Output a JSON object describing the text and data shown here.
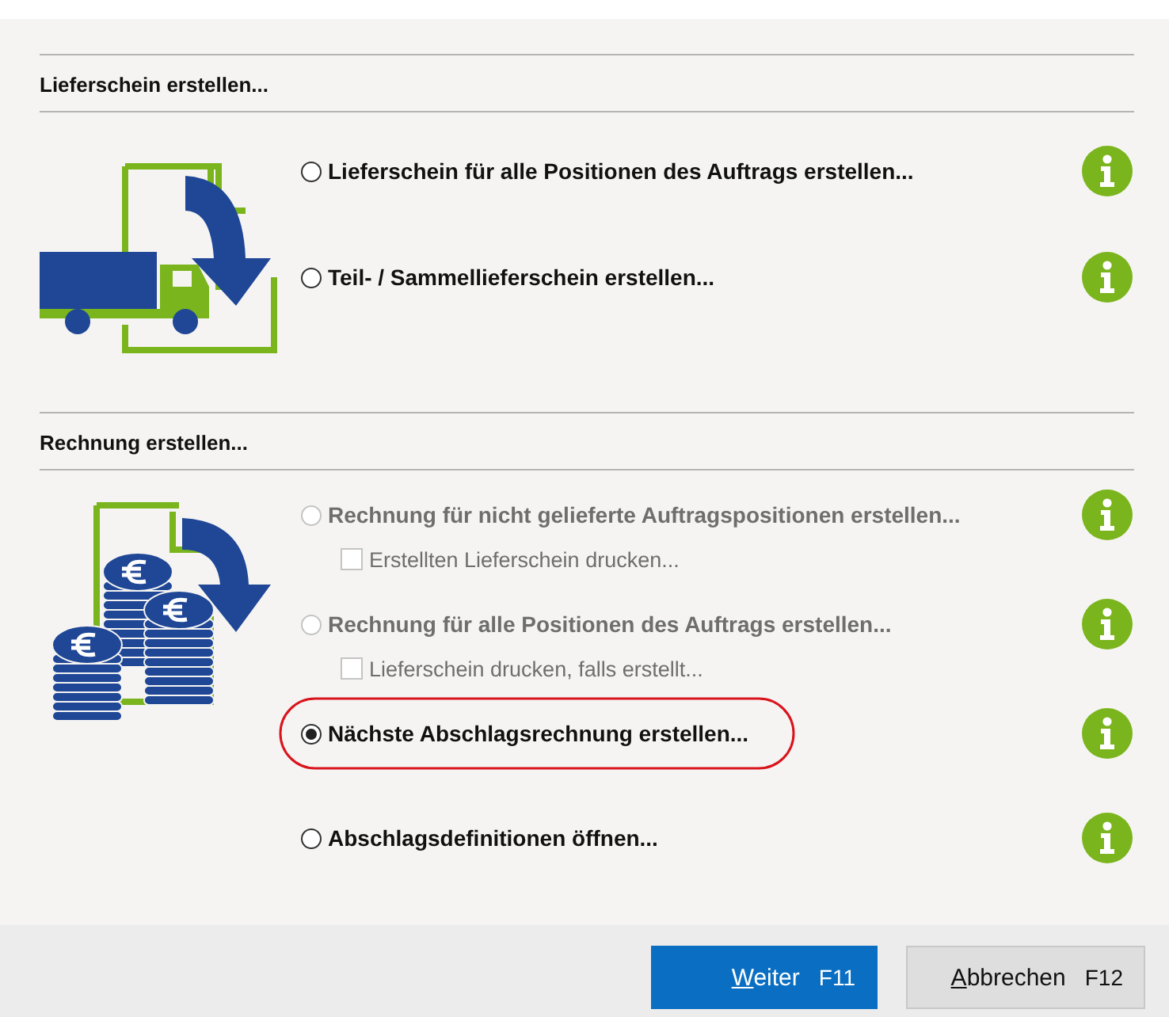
{
  "sections": [
    {
      "title": "Lieferschein erstellen...",
      "kind": "truck",
      "options": [
        {
          "kind": "radio",
          "label": "Lieferschein für alle Positionen des Auftrags erstellen...",
          "selected": false,
          "disabled": false,
          "highlighted": false
        },
        {
          "kind": "radio",
          "label": "Teil- / Sammellieferschein erstellen...",
          "selected": false,
          "disabled": false,
          "highlighted": false
        }
      ]
    },
    {
      "title": "Rechnung erstellen...",
      "kind": "coins",
      "options": [
        {
          "kind": "radio",
          "label": "Rechnung für nicht gelieferte Auftragspositionen erstellen...",
          "selected": false,
          "disabled": true,
          "highlighted": false
        },
        {
          "kind": "checkbox",
          "label": "Erstellten Lieferschein drucken...",
          "checked": false,
          "disabled": true
        },
        {
          "kind": "radio",
          "label": "Rechnung für alle Positionen des Auftrags erstellen...",
          "selected": false,
          "disabled": true,
          "highlighted": false
        },
        {
          "kind": "checkbox",
          "label": "Lieferschein drucken, falls erstellt...",
          "checked": false,
          "disabled": true
        },
        {
          "kind": "radio",
          "label": "Nächste Abschlagsrechnung erstellen...",
          "selected": true,
          "disabled": false,
          "highlighted": true
        },
        {
          "kind": "radio",
          "label": "Abschlagsdefinitionen öffnen...",
          "selected": false,
          "disabled": false,
          "highlighted": false
        }
      ]
    }
  ],
  "buttons": [
    {
      "label": "Weiter",
      "shortcut": "F11",
      "primary": true
    },
    {
      "label": "Abbrechen",
      "shortcut": "F12",
      "primary": false
    }
  ]
}
